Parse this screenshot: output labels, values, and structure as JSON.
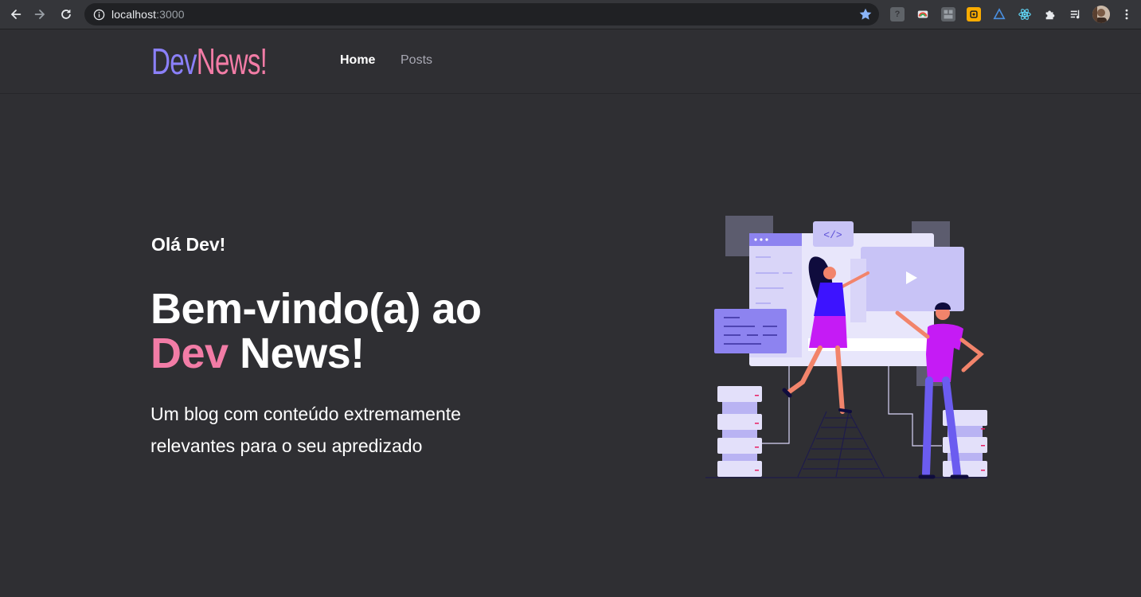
{
  "browser": {
    "url_host": "localhost",
    "url_port": ":3000",
    "icons": [
      "back-icon",
      "forward-icon",
      "reload-icon",
      "info-icon",
      "bookmark-star-icon",
      "extensions-puzzle-icon",
      "media-control-icon",
      "profile-avatar",
      "menu-kebab-icon"
    ]
  },
  "header": {
    "logo_dev": "Dev",
    "logo_news": "News!",
    "nav": [
      {
        "label": "Home",
        "active": true
      },
      {
        "label": "Posts",
        "active": false
      }
    ]
  },
  "hero": {
    "greeting": "Olá Dev!",
    "title_line1": "Bem-vindo(a) ao",
    "title_accent": "Dev",
    "title_rest": "News!",
    "subtitle": "Um blog com conteúdo extremamente relevantes para o seu apredizado",
    "illustration_code_tag": "</>"
  },
  "colors": {
    "background": "#2f2f33",
    "logo_purple": "#8b80f9",
    "accent_pink": "#f27ca6",
    "muted_text": "#a8a8b3"
  }
}
